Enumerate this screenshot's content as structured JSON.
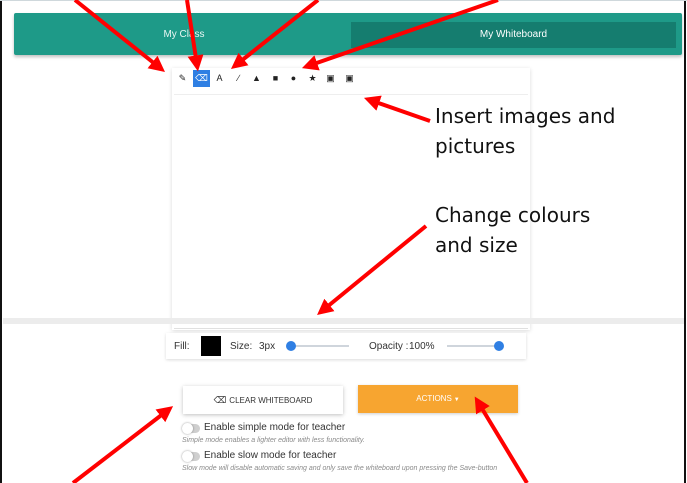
{
  "tabs": [
    {
      "label": "My Class"
    },
    {
      "label": "My Whiteboard"
    }
  ],
  "toolbar": {
    "tools": [
      {
        "name": "pencil-icon",
        "glyph": "✎"
      },
      {
        "name": "eraser-icon",
        "glyph": "⌫"
      },
      {
        "name": "text-icon",
        "glyph": "A"
      },
      {
        "name": "line-icon",
        "glyph": "∕"
      },
      {
        "name": "triangle-icon",
        "glyph": "▲"
      },
      {
        "name": "square-icon",
        "glyph": "■"
      },
      {
        "name": "circle-icon",
        "glyph": "●"
      },
      {
        "name": "star-icon",
        "glyph": "★"
      },
      {
        "name": "image-icon",
        "glyph": "▣"
      },
      {
        "name": "picture-icon",
        "glyph": "▣"
      }
    ],
    "active_tool": "eraser-icon"
  },
  "properties": {
    "fill_label": "Fill:",
    "fill_color": "#000000",
    "size_label": "Size:",
    "size_value": "3px",
    "size_level": 0,
    "opacity_label": "Opacity :",
    "opacity_value": "100%",
    "opacity_level": 1
  },
  "buttons": {
    "clear_label": "CLEAR WHITEBOARD",
    "actions_label": "ACTIONS"
  },
  "toggles": {
    "simple_label": "Enable simple mode for teacher",
    "simple_hint": "Simple mode enables a lighter editor with less functionality.",
    "slow_label": "Enable slow mode for teacher",
    "slow_hint": "Slow mode will disable automatic saving and only save the whiteboard upon pressing the Save-button"
  },
  "annotations": {
    "insert_images": [
      "Insert images and",
      "pictures"
    ],
    "change_colours": [
      "Change colours",
      "and size"
    ]
  },
  "colors": {
    "tabbar": "#1e9a88",
    "tab_active": "#157d6f",
    "accent_blue": "#2f7fe3",
    "actions_orange": "#f7a530",
    "arrow_red": "#ff0000"
  }
}
